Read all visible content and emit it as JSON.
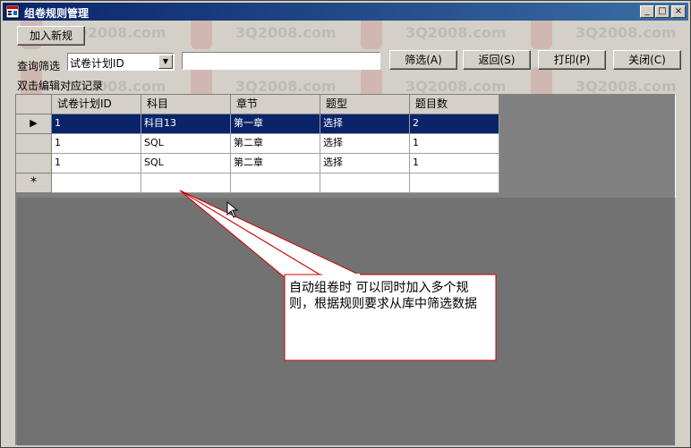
{
  "window": {
    "title": "组卷规则管理",
    "controls": {
      "minimize": "_",
      "maximize": "□",
      "close": "×"
    }
  },
  "toolbar": {
    "add_new_label": "加入新规",
    "filter_label": "查询筛选",
    "filter_field": "试卷计划ID",
    "filter_value": "",
    "filter_button": "筛选(A)",
    "back_button": "返回(S)",
    "print_button": "打印(P)",
    "close_button": "关闭(C)"
  },
  "hint": "双击编辑对应记录",
  "grid": {
    "columns": [
      "试卷计划ID",
      "科目",
      "章节",
      "题型",
      "题目数"
    ],
    "rows": [
      {
        "plan_id": "1",
        "subject": "科目13",
        "chapter": "第一章",
        "type": "选择",
        "count": "2"
      },
      {
        "plan_id": "1",
        "subject": "SQL",
        "chapter": "第二章",
        "type": "选择",
        "count": "1"
      },
      {
        "plan_id": "1",
        "subject": "SQL",
        "chapter": "第二章",
        "type": "选择",
        "count": "1"
      }
    ],
    "current_row_marker": "▶",
    "new_row_marker": "*"
  },
  "callout": {
    "text": "自动组卷时 可以同时加入多个规则，根据规则要求从库中筛选数据"
  },
  "watermark": {
    "text": "3Q2008.com"
  },
  "colors": {
    "titlebar_start": "#0a246a",
    "titlebar_end": "#3a6ea5",
    "selection": "#0a246a",
    "callout_border": "#cc0000"
  }
}
